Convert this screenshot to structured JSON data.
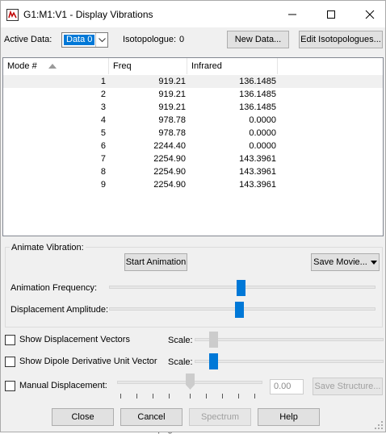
{
  "window": {
    "title": "G1:M1:V1 - Display Vibrations"
  },
  "toolbar": {
    "active_data_label": "Active Data:",
    "active_data_value": "Data 0",
    "isotopologue_label": "Isotopologue:",
    "isotopologue_value": "0",
    "new_data_label": "New Data...",
    "edit_isotopologues_label": "Edit Isotopologues..."
  },
  "table": {
    "columns": [
      "Mode #",
      "Freq",
      "Infrared"
    ],
    "rows": [
      {
        "mode": "1",
        "freq": "919.21",
        "ir": "136.1485"
      },
      {
        "mode": "2",
        "freq": "919.21",
        "ir": "136.1485"
      },
      {
        "mode": "3",
        "freq": "919.21",
        "ir": "136.1485"
      },
      {
        "mode": "4",
        "freq": "978.78",
        "ir": "0.0000"
      },
      {
        "mode": "5",
        "freq": "978.78",
        "ir": "0.0000"
      },
      {
        "mode": "6",
        "freq": "2244.40",
        "ir": "0.0000"
      },
      {
        "mode": "7",
        "freq": "2254.90",
        "ir": "143.3961"
      },
      {
        "mode": "8",
        "freq": "2254.90",
        "ir": "143.3961"
      },
      {
        "mode": "9",
        "freq": "2254.90",
        "ir": "143.3961"
      }
    ],
    "selected_row_index": 0
  },
  "animate": {
    "group_label": "Animate Vibration:",
    "start_button": "Start Animation",
    "save_movie_button": "Save Movie...",
    "frequency_label": "Animation Frequency:",
    "amplitude_label": "Displacement Amplitude:"
  },
  "options": {
    "show_displacement_vectors": "Show Displacement Vectors",
    "show_dipole_derivative": "Show Dipole Derivative Unit Vector",
    "scale_label": "Scale:",
    "manual_displacement": "Manual Displacement:",
    "manual_value": "0.00",
    "save_structure_button": "Save Structure..."
  },
  "footer": {
    "close": "Close",
    "cancel": "Cancel",
    "spectrum": "Spectrum",
    "help": "Help",
    "behind_text": "This is a minor edit      Watch this page"
  },
  "colors": {
    "accent": "#0078d7",
    "window_bg": "#f0f0f0"
  }
}
